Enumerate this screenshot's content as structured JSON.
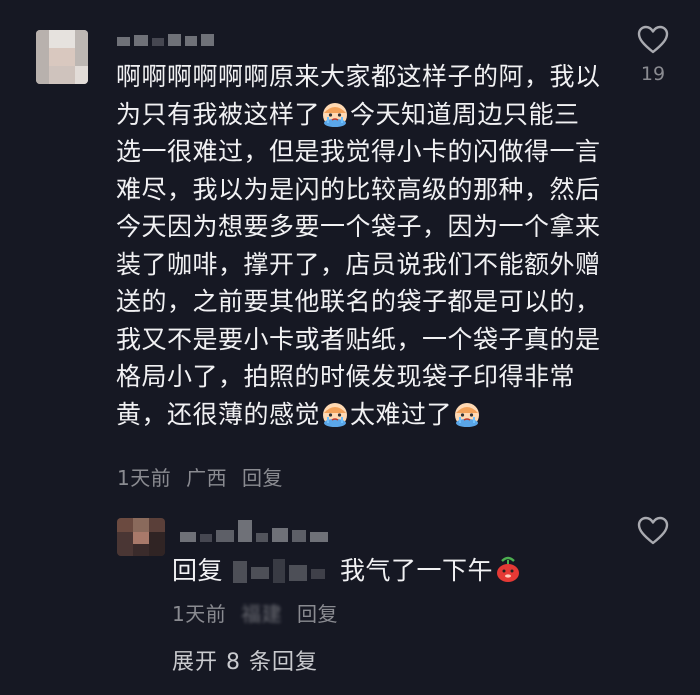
{
  "comment": {
    "lines": [
      "啊啊啊啊啊啊原来大家都这样子的阿，我以",
      "为只有我被这样了",
      "今天知道周边只能三",
      "选一很难过，但是我觉得小卡的闪做得一言",
      "难尽，我以为是闪的比较高级的那种，然后",
      "今天因为想要多要一个袋子，因为一个拿来",
      "装了咖啡，撑开了，店员说我们不能额外赠",
      "送的，之前要其他联名的袋子都是可以的，",
      "我又不是要小卡或者贴纸，一个袋子真的是",
      "格局小了，拍照的时候发现袋子印得非常",
      "黄，还很薄的感觉",
      "太难过了"
    ],
    "emoji": "crying-face-emoji",
    "time": "1天前",
    "location": "广西",
    "reply_label": "回复",
    "like_count": "19"
  },
  "reply": {
    "prefix": "回复",
    "text": "我气了一下午",
    "emoji": "red-bean-emoji",
    "time": "1天前",
    "location": "福建",
    "reply_label": "回复"
  },
  "expand_label": "展开 8 条回复",
  "colors": {
    "background": "#161823",
    "text": "#f1f1f3",
    "meta": "#8a8b91"
  }
}
